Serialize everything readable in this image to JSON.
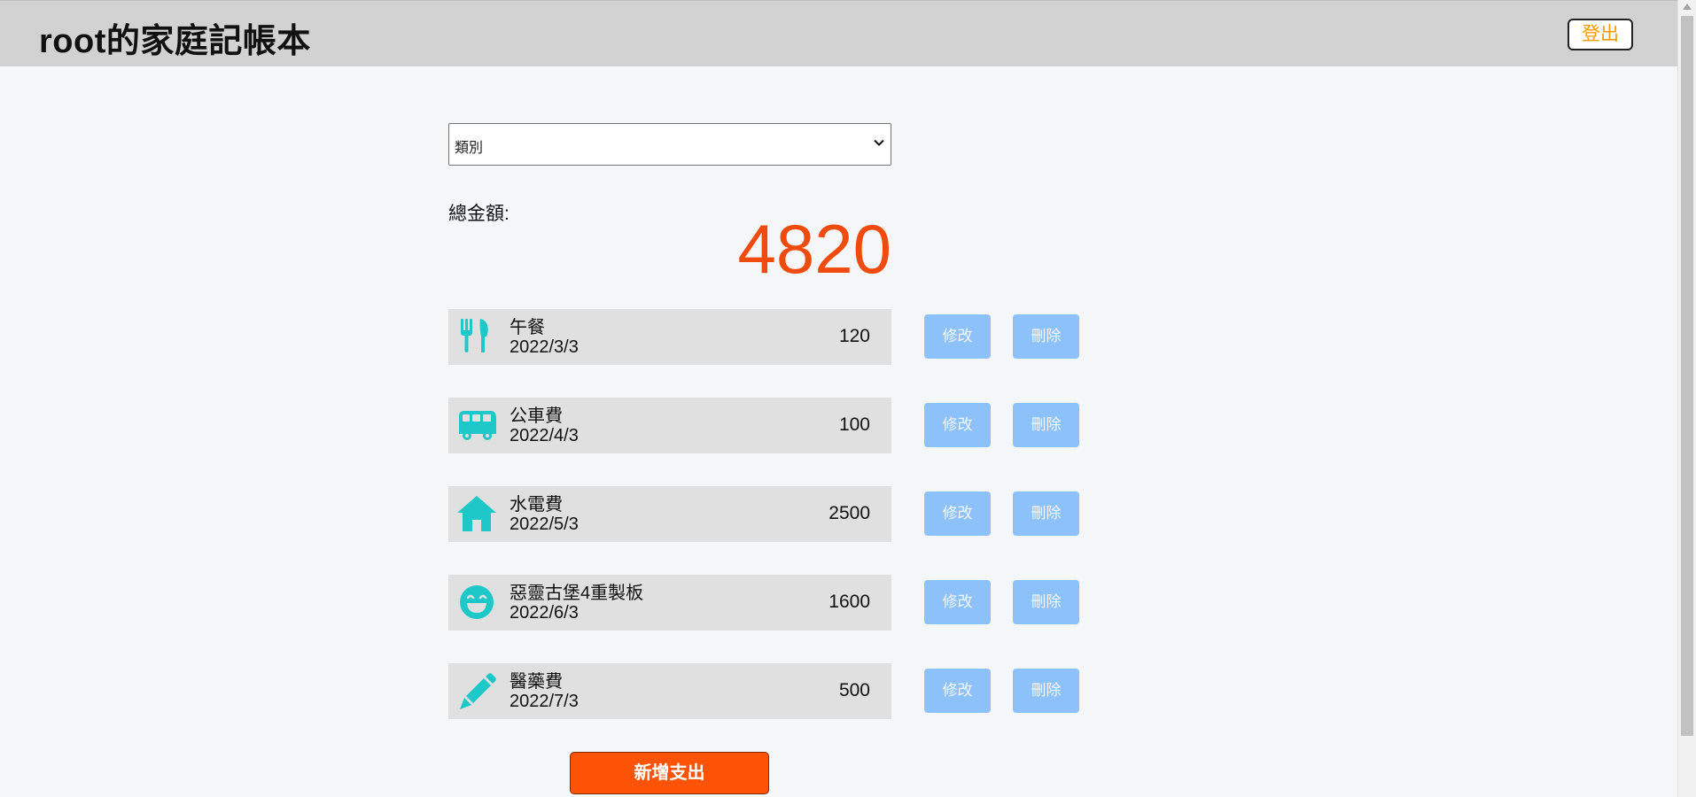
{
  "header": {
    "title": "root的家庭記帳本",
    "logout_label": "登出"
  },
  "filter": {
    "category_selected": "類別"
  },
  "summary": {
    "total_label": "總金額:",
    "total_value": "4820"
  },
  "expenses": [
    {
      "icon": "utensils-icon",
      "name": "午餐",
      "date": "2022/3/3",
      "amount": "120",
      "edit_label": "修改",
      "delete_label": "刪除"
    },
    {
      "icon": "bus-icon",
      "name": "公車費",
      "date": "2022/4/3",
      "amount": "100",
      "edit_label": "修改",
      "delete_label": "刪除"
    },
    {
      "icon": "home-icon",
      "name": "水電費",
      "date": "2022/5/3",
      "amount": "2500",
      "edit_label": "修改",
      "delete_label": "刪除"
    },
    {
      "icon": "smile-icon",
      "name": "惡靈古堡4重製板",
      "date": "2022/6/3",
      "amount": "1600",
      "edit_label": "修改",
      "delete_label": "刪除"
    },
    {
      "icon": "pencil-icon",
      "name": "醫藥費",
      "date": "2022/7/3",
      "amount": "500",
      "edit_label": "修改",
      "delete_label": "刪除"
    }
  ],
  "actions": {
    "add_label": "新增支出"
  },
  "colors": {
    "icon": "#1ec8c8",
    "total": "#f04b0e",
    "logout_text": "#f59a00",
    "action_button": "#8cc1fa",
    "add_button": "#fc5307"
  }
}
